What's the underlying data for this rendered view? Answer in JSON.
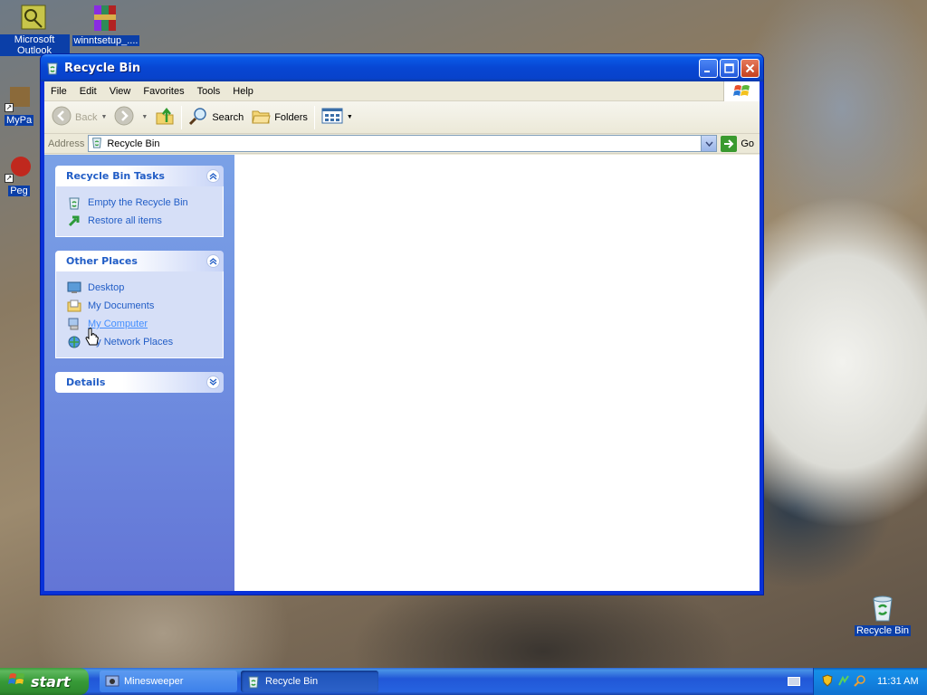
{
  "desktop": {
    "icons": [
      {
        "label": "Microsoft Outlook"
      },
      {
        "label": "winntsetup_...."
      },
      {
        "label": "MyPa"
      },
      {
        "label": "Peg"
      },
      {
        "label": "Recycle Bin"
      }
    ]
  },
  "window": {
    "title": "Recycle Bin",
    "menu": [
      "File",
      "Edit",
      "View",
      "Favorites",
      "Tools",
      "Help"
    ],
    "toolbar": {
      "back_label": "Back",
      "search_label": "Search",
      "folders_label": "Folders"
    },
    "address": {
      "label": "Address",
      "value": "Recycle Bin",
      "go_label": "Go"
    },
    "taskpane": {
      "groups": [
        {
          "title": "Recycle Bin Tasks",
          "items": [
            "Empty the Recycle Bin",
            "Restore all items"
          ]
        },
        {
          "title": "Other Places",
          "items": [
            "Desktop",
            "My Documents",
            "My Computer",
            "My Network Places"
          ]
        },
        {
          "title": "Details",
          "items": []
        }
      ]
    }
  },
  "taskbar": {
    "start_label": "start",
    "buttons": [
      "Minesweeper",
      "Recycle Bin"
    ],
    "clock": "11:31 AM"
  },
  "colors": {
    "titlebar": "#0a5ae8",
    "taskpane_link": "#215dc6",
    "start_green": "#379a37"
  }
}
